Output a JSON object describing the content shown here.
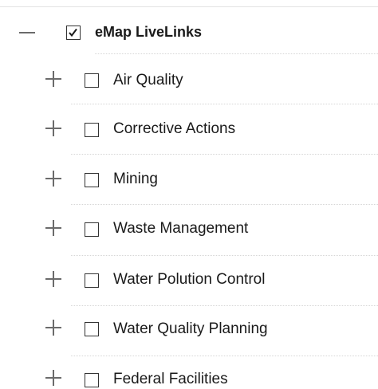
{
  "tree": {
    "root": {
      "label": "eMap LiveLinks",
      "expanded": true,
      "checked": true,
      "toggle_icon": "collapse-minus-icon"
    },
    "children": [
      {
        "label": "Air Quality",
        "expanded": false,
        "checked": false,
        "toggle_icon": "expand-plus-icon"
      },
      {
        "label": "Corrective Actions",
        "expanded": false,
        "checked": false,
        "toggle_icon": "expand-plus-icon"
      },
      {
        "label": "Mining",
        "expanded": false,
        "checked": false,
        "toggle_icon": "expand-plus-icon"
      },
      {
        "label": "Waste Management",
        "expanded": false,
        "checked": false,
        "toggle_icon": "expand-plus-icon"
      },
      {
        "label": "Water Polution Control",
        "expanded": false,
        "checked": false,
        "toggle_icon": "expand-plus-icon"
      },
      {
        "label": "Water Quality Planning",
        "expanded": false,
        "checked": false,
        "toggle_icon": "expand-plus-icon"
      },
      {
        "label": "Federal Facilities",
        "expanded": false,
        "checked": false,
        "toggle_icon": "expand-plus-icon"
      }
    ]
  },
  "colors": {
    "text": "#1a1a1a",
    "toggle": "#6b6b6b",
    "checkbox_border": "#333333",
    "divider": "#d6d6d6"
  }
}
